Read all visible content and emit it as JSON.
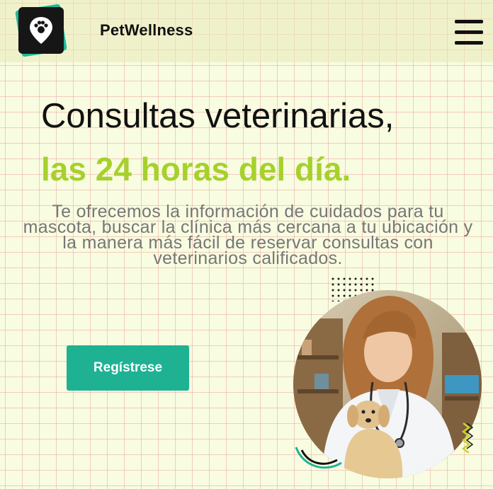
{
  "header": {
    "brand": "PetWellness",
    "logo_icon": "paw-location-pin-icon",
    "menu_icon": "hamburger-menu-icon"
  },
  "hero": {
    "title_line1": "Consultas veterinarias,",
    "title_line2_part1": "las ",
    "title_line2_highlight": "24 horas",
    "title_line2_part2": " del día.",
    "description": "Te ofrecemos la información de cuidados para tu mascota, buscar la clínica más cercana a tu ubicación y la manera más fácil de reservar consultas con veterinarios calificados.",
    "cta_label": "Regístrese",
    "image": "veterinarian-with-puppy-photo"
  },
  "colors": {
    "accent_green": "#a6d12c",
    "button_teal": "#1eb293",
    "header_bg": "#ededbd",
    "page_bg": "#f8fce0",
    "grid_line": "#e89696"
  }
}
